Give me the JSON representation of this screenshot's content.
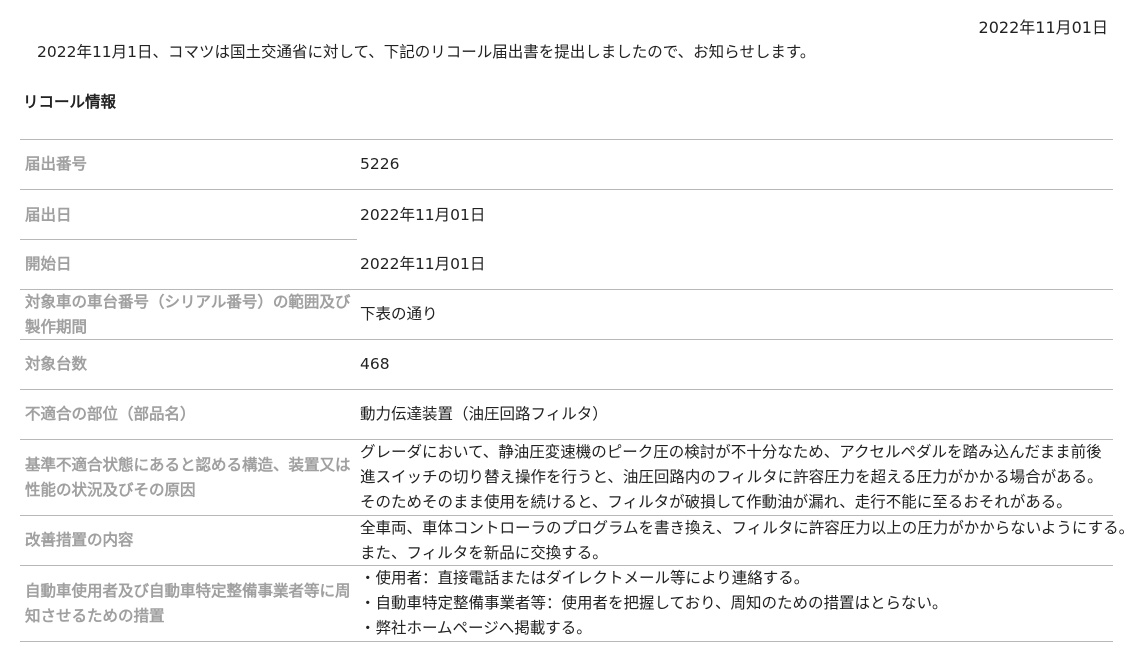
{
  "date": "2022年11月01日",
  "intro": "2022年11月1日、コマツは国土交通省に対して、下記のリコール届出書を提出しましたので、お知らせします。",
  "section_title": "リコール情報",
  "rows": [
    {
      "label": "届出番号",
      "value": [
        "5226"
      ]
    },
    {
      "label": "届出日",
      "value": [
        "2022年11月01日"
      ]
    },
    {
      "label": "開始日",
      "value": [
        "2022年11月01日"
      ]
    },
    {
      "label": "対象車の車台番号（シリアル番号）の範囲及び製作期間",
      "value": [
        "下表の通り"
      ]
    },
    {
      "label": "対象台数",
      "value": [
        "468"
      ]
    },
    {
      "label": "不適合の部位（部品名）",
      "value": [
        "動力伝達装置（油圧回路フィルタ）"
      ]
    },
    {
      "label": "基準不適合状態にあると認める構造、装置又は性能の状況及びその原因",
      "value": [
        "グレーダにおいて、静油圧変速機のピーク圧の検討が不十分なため、アクセルペダルを踏み込んだまま前後",
        "進スイッチの切り替え操作を行うと、油圧回路内のフィルタに許容圧力を超える圧力がかかる場合がある。",
        "そのためそのまま使用を続けると、フィルタが破損して作動油が漏れ、走行不能に至るおそれがある。"
      ]
    },
    {
      "label": "改善措置の内容",
      "value": [
        "全車両、車体コントローラのプログラムを書き換え、フィルタに許容圧力以上の圧力がかからないようにする。",
        "また、フィルタを新品に交換する。"
      ]
    },
    {
      "label": "自動車使用者及び自動車特定整備事業者等に周知させるための措置",
      "value": [
        "・使用者：直接電話またはダイレクトメール等により連絡する。",
        "・自動車特定整備事業者等：使用者を把握しており、周知のための措置はとらない。",
        "・弊社ホームページへ掲載する。"
      ]
    }
  ]
}
